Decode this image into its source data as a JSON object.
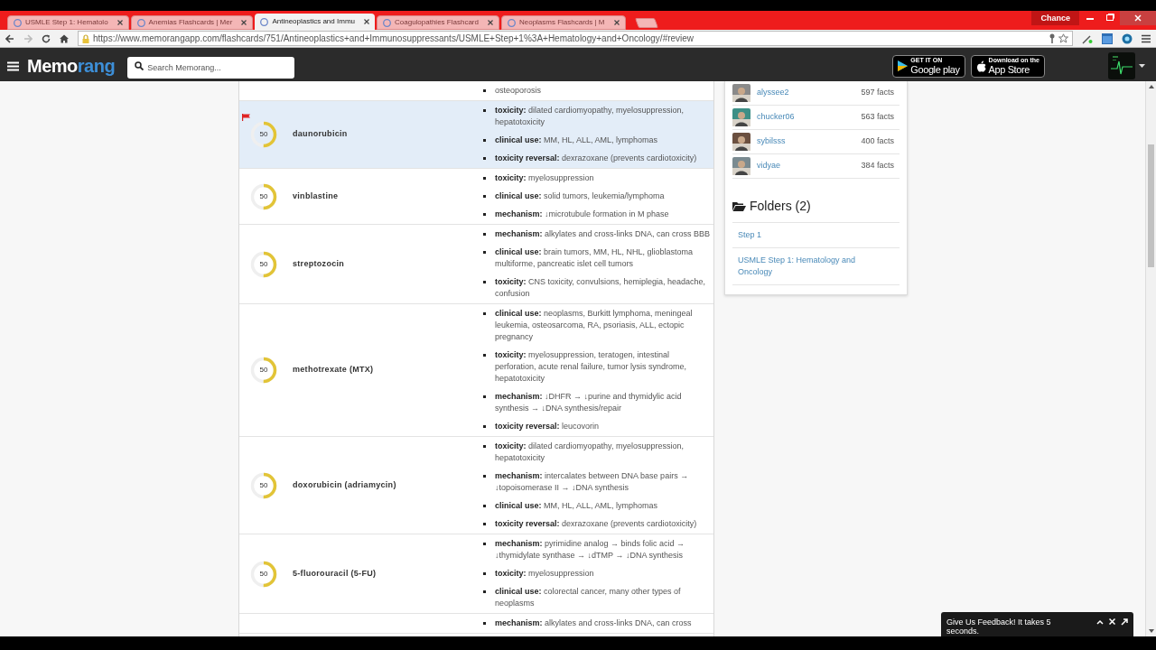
{
  "browser": {
    "profile": "Chance",
    "url": "https://www.memorangapp.com/flashcards/751/Antineoplastics+and+Immunosuppressants/USMLE+Step+1%3A+Hematology+and+Oncology/#review",
    "tabs": [
      {
        "label": "USMLE Step 1: Hematolo",
        "selected": false
      },
      {
        "label": "Anemias Flashcards | Mer",
        "selected": false
      },
      {
        "label": "Antineoplastics and Immu",
        "selected": true
      },
      {
        "label": "Coagulopathies Flashcard",
        "selected": false
      },
      {
        "label": "Neoplasms Flashcards | M",
        "selected": false
      }
    ]
  },
  "navbar": {
    "logo": [
      "Memo",
      "rang"
    ],
    "search": {
      "placeholder": "Search Memorang..."
    },
    "badges": [
      {
        "kind": "google",
        "small": "GET IT ON",
        "big": "Google play"
      },
      {
        "kind": "apple",
        "small": "Download on the",
        "big": "App Store"
      }
    ]
  },
  "cards": [
    {
      "facts": [
        {
          "text": "osteoporosis"
        }
      ]
    },
    {
      "term": "daunorubicin",
      "score": "50",
      "level": 0.5,
      "selected": true,
      "flagged": true,
      "facts": [
        {
          "label": "toxicity:",
          "text": "dilated cardiomyopathy, myelosuppression, hepatotoxicity"
        },
        {
          "label": "clinical use:",
          "text": "MM, HL, ALL, AML, lymphomas"
        },
        {
          "label": "toxicity reversal:",
          "text": "dexrazoxane (prevents cardiotoxicity)"
        }
      ]
    },
    {
      "term": "vinblastine",
      "score": "50",
      "level": 0.5,
      "selected": false,
      "flagged": false,
      "facts": [
        {
          "label": "toxicity:",
          "text": "myelosuppression"
        },
        {
          "label": "clinical use:",
          "text": "solid tumors, leukemia/lymphoma"
        },
        {
          "label": "mechanism:",
          "text": "↓microtubule formation in M phase"
        }
      ]
    },
    {
      "term": "streptozocin",
      "score": "50",
      "level": 0.5,
      "selected": false,
      "flagged": false,
      "facts": [
        {
          "label": "mechanism:",
          "text": "alkylates and cross-links DNA, can cross BBB"
        },
        {
          "label": "clinical use:",
          "text": "brain tumors, MM, HL, NHL, glioblastoma multiforme, pancreatic islet cell tumors"
        },
        {
          "label": "toxicity:",
          "text": "CNS toxicity, convulsions, hemiplegia, headache, confusion"
        }
      ]
    },
    {
      "term": "methotrexate (MTX)",
      "score": "50",
      "level": 0.5,
      "selected": false,
      "flagged": false,
      "facts": [
        {
          "label": "clinical use:",
          "text": "neoplasms, Burkitt lymphoma, meningeal leukemia, osteosarcoma, RA, psoriasis, ALL, ectopic pregnancy"
        },
        {
          "label": "toxicity:",
          "text": "myelosuppression, teratogen, intestinal perforation, acute renal failure, tumor lysis syndrome, hepatotoxicity"
        },
        {
          "label": "mechanism:",
          "text": "↓DHFR → ↓purine and thymidylic acid synthesis → ↓DNA synthesis/repair"
        },
        {
          "label": "toxicity reversal:",
          "text": "leucovorin"
        }
      ]
    },
    {
      "term": "doxorubicin (adriamycin)",
      "score": "50",
      "level": 0.5,
      "selected": false,
      "flagged": false,
      "facts": [
        {
          "label": "toxicity:",
          "text": "dilated cardiomyopathy, myelosuppression, hepatotoxicity"
        },
        {
          "label": "mechanism:",
          "text": "intercalates between DNA base pairs → ↓topoisomerase II → ↓DNA synthesis"
        },
        {
          "label": "clinical use:",
          "text": "MM, HL, ALL, AML, lymphomas"
        },
        {
          "label": "toxicity reversal:",
          "text": "dexrazoxane (prevents cardiotoxicity)"
        }
      ]
    },
    {
      "term": "5-fluorouracil (5-FU)",
      "score": "50",
      "level": 0.5,
      "selected": false,
      "flagged": false,
      "facts": [
        {
          "label": "mechanism:",
          "text": "pyrimidine analog → binds folic acid → ↓thymidylate synthase → ↓dTMP → ↓DNA synthesis"
        },
        {
          "label": "toxicity:",
          "text": "myelosuppression"
        },
        {
          "label": "clinical use:",
          "text": "colorectal cancer, many other types of neoplasms"
        }
      ]
    },
    {
      "facts": [
        {
          "label": "mechanism:",
          "text": "alkylates and cross-links DNA, can cross"
        }
      ]
    }
  ],
  "sidebar": {
    "users": [
      {
        "name": "alyssee2",
        "facts": "597 facts"
      },
      {
        "name": "chucker06",
        "facts": "563 facts"
      },
      {
        "name": "sybilsss",
        "facts": "400 facts"
      },
      {
        "name": "vidyae",
        "facts": "384 facts"
      }
    ],
    "folders_title": "Folders (2)",
    "folders": [
      "Step 1",
      "USMLE Step 1: Hematology and Oncology"
    ]
  },
  "feedback": {
    "text": "Give Us Feedback! It takes 5 seconds."
  }
}
